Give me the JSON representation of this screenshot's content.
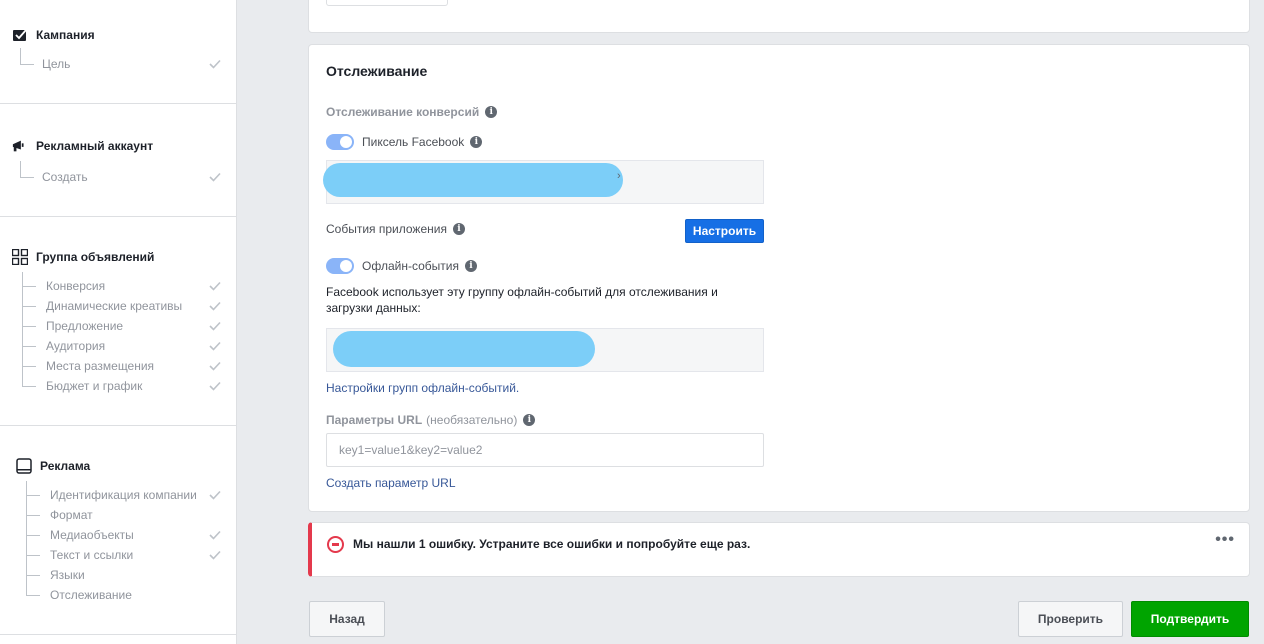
{
  "sidebar": {
    "campaign": {
      "title": "Кампания",
      "items": [
        {
          "label": "Цель",
          "done": true
        }
      ]
    },
    "ad_account": {
      "title": "Рекламный аккаунт",
      "items": [
        {
          "label": "Создать",
          "done": true
        }
      ]
    },
    "ad_set": {
      "title": "Группа объявлений",
      "items": [
        {
          "label": "Конверсия",
          "done": true
        },
        {
          "label": "Динамические креативы",
          "done": true
        },
        {
          "label": "Предложение",
          "done": true
        },
        {
          "label": "Аудитория",
          "done": true
        },
        {
          "label": "Места размещения",
          "done": true
        },
        {
          "label": "Бюджет и график",
          "done": true
        }
      ]
    },
    "ad": {
      "title": "Реклама",
      "items": [
        {
          "label": "Идентификация компании",
          "done": true
        },
        {
          "label": "Формат",
          "done": false
        },
        {
          "label": "Медиаобъекты",
          "done": true
        },
        {
          "label": "Текст и ссылки",
          "done": true
        },
        {
          "label": "Языки",
          "done": false
        },
        {
          "label": "Отслеживание",
          "done": false
        }
      ]
    }
  },
  "tracking": {
    "title": "Отслеживание",
    "conversion_label": "Отслеживание конверсий",
    "pixel_label": "Пиксель Facebook",
    "pixel_enabled": true,
    "app_events_label": "События приложения",
    "configure_button": "Настроить",
    "offline_label": "Офлайн-события",
    "offline_enabled": true,
    "offline_description": "Facebook использует эту группу офлайн-событий для отслеживания и загрузки данных:",
    "offline_settings_link": "Настройки групп офлайн-событий.",
    "url_params_label": "Параметры URL",
    "url_params_optional": "(необязательно)",
    "url_params_placeholder": "key1=value1&key2=value2",
    "create_url_param_link": "Создать параметр URL"
  },
  "error": {
    "message": "Мы нашли 1 ошибку. Устраните все ошибки и попробуйте еще раз.",
    "more": "•••"
  },
  "footer": {
    "back_button": "Назад",
    "review_button": "Проверить",
    "confirm_button": "Подтвердить"
  },
  "colors": {
    "accent_blue": "#166fe5",
    "confirm_green": "#00a400",
    "error_red": "#e4394c",
    "redaction": "#7ccef8"
  }
}
